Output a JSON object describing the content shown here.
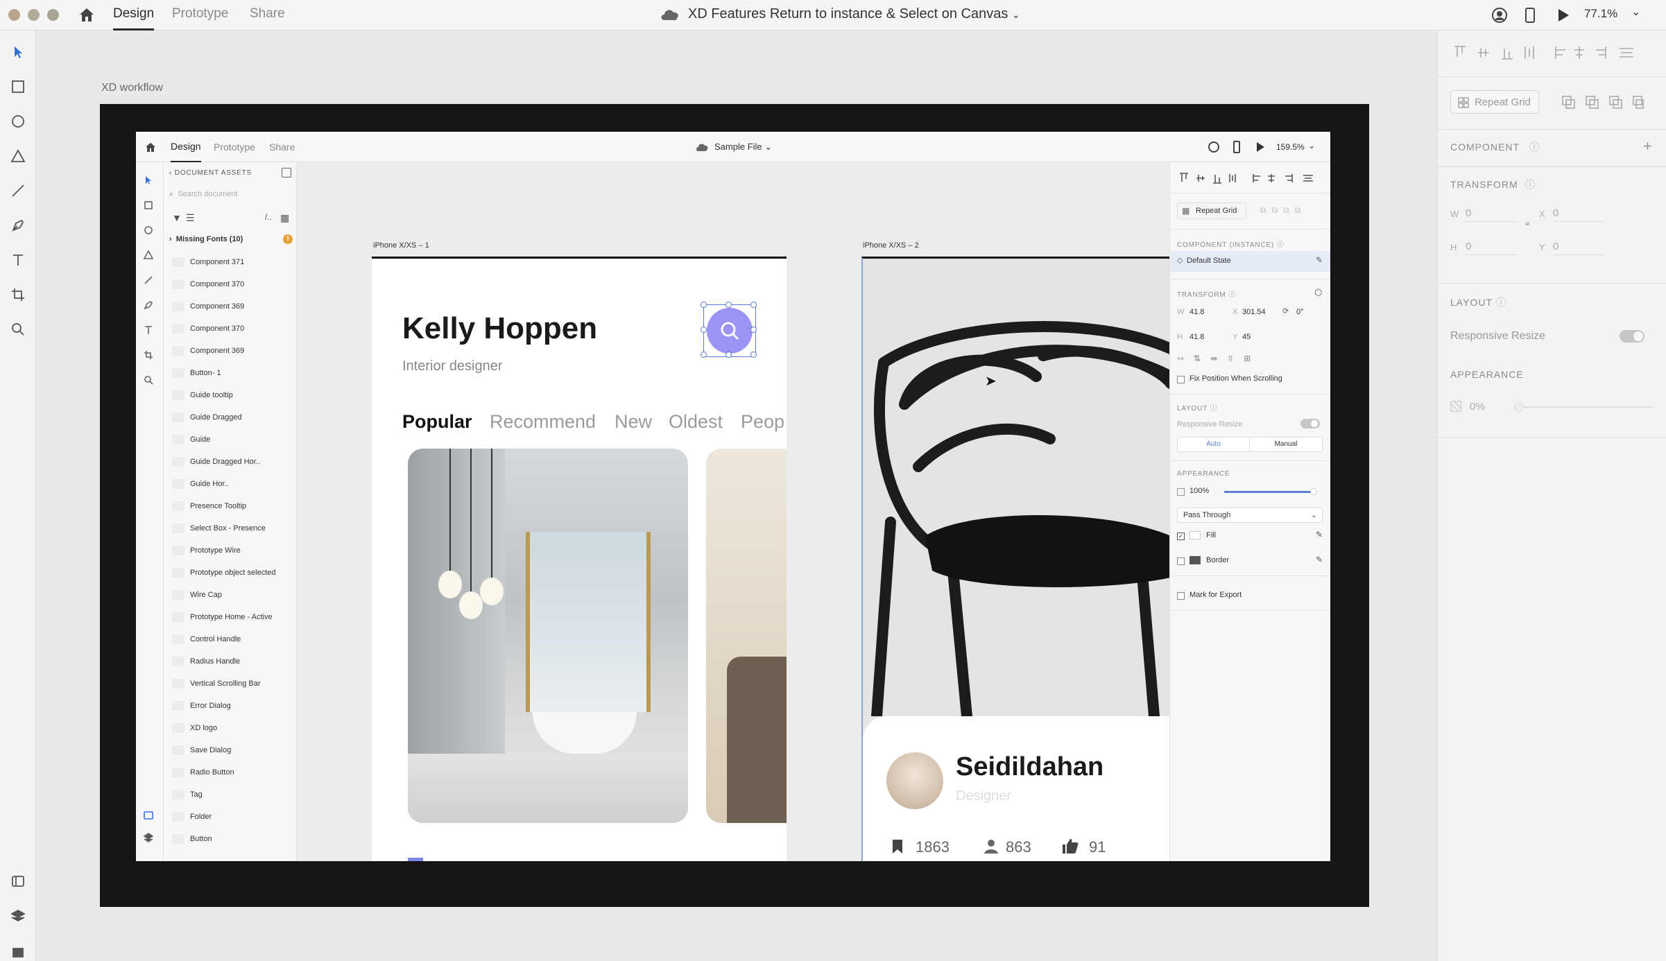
{
  "app": {
    "tabs": [
      "Design",
      "Prototype",
      "Share"
    ],
    "document_title": "XD Features Return to instance & Select on Canvas",
    "zoom": "77.1%"
  },
  "properties": {
    "repeat_grid": "Repeat Grid",
    "component_label": "COMPONENT",
    "transform_label": "TRANSFORM",
    "w_label": "W",
    "w_value": "0",
    "x_label": "X",
    "x_value": "0",
    "h_label": "H",
    "h_value": "0",
    "y_label": "Y",
    "y_value": "0",
    "layout_label": "LAYOUT",
    "responsive_resize": "Responsive Resize",
    "appearance_label": "APPEARANCE",
    "opacity": "0%"
  },
  "canvas": {
    "artboard_label": "XD workflow"
  },
  "inner_app": {
    "tabs": [
      "Design",
      "Prototype",
      "Share"
    ],
    "document_title": "Sample File",
    "zoom": "159.5%",
    "assets": {
      "header": "DOCUMENT ASSETS",
      "search_placeholder": "Search document",
      "missing_fonts": "Missing Fonts (10)",
      "items": [
        "Component 371",
        "Component 370",
        "Component 369",
        "Component 370",
        "Component 369",
        "Button- 1",
        "Guide tooltip",
        "Guide Dragged",
        "Guide",
        "Guide Dragged Hor..",
        "Guide Hor..",
        "Presence Tooltip",
        "Select Box - Presence",
        "Prototype Wire",
        "Prototype object selected",
        "Wire Cap",
        "Prototype Home - Active",
        "Control Handle",
        "Radius Handle",
        "Vertical Scrolling Bar",
        "Error Dialog",
        "XD logo",
        "Save Dialog",
        "Radio Button",
        "Tag",
        "Folder",
        "Button"
      ]
    },
    "props": {
      "repeat_grid": "Repeat Grid",
      "component_instance": "COMPONENT (INSTANCE)",
      "default_state": "Default State",
      "transform": "TRANSFORM",
      "w": "41.8",
      "x": "301.54",
      "rotation": "0°",
      "h": "41.8",
      "y": "45",
      "fix_position": "Fix Position When Scrolling",
      "layout": "LAYOUT",
      "responsive_resize": "Responsive Resize",
      "auto": "Auto",
      "manual": "Manual",
      "appearance": "APPEARANCE",
      "opacity": "100%",
      "blend_mode": "Pass Through",
      "fill": "Fill",
      "border": "Border",
      "mark_export": "Mark for Export"
    },
    "artboard1": {
      "label": "iPhone X/XS – 1",
      "name": "Kelly Hoppen",
      "role": "Interior designer",
      "tabs": [
        "Popular",
        "Recommend",
        "New",
        "Oldest",
        "Peop"
      ]
    },
    "artboard2": {
      "label": "iPhone X/XS – 2",
      "name": "Seidildahan",
      "role": "Designer",
      "bookmarks": "1863",
      "followers": "863",
      "likes": "91"
    }
  },
  "colors": {
    "accent_purple": "#9a94f4",
    "dark_frame": "#151515",
    "slider_blue": "#5b7fd6"
  }
}
